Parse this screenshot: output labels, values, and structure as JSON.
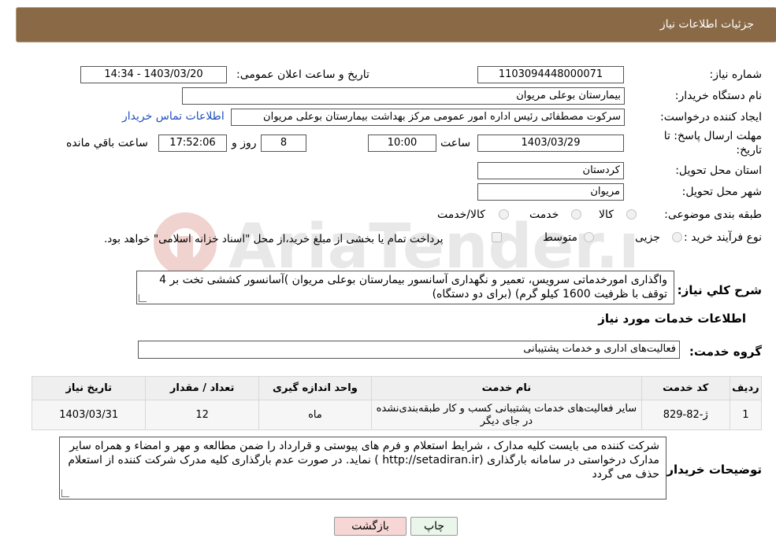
{
  "header": {
    "title": "جزئیات اطلاعات نیاز"
  },
  "form": {
    "need_number_label": "شماره نیاز:",
    "need_number": "1103094448000071",
    "announce_label": "تاریخ و ساعت اعلان عمومی:",
    "announce_value": "1403/03/20 - 14:34",
    "buyer_org_label": "نام دستگاه خریدار:",
    "buyer_org": "بیمارستان بوعلی مریوان",
    "creator_label": "ایجاد کننده درخواست:",
    "creator": "سرکوت مصطفائی رئیس اداره امور عمومی مرکز بهداشت بیمارستان بوعلی مریوان",
    "contact_link": "اطلاعات تماس خریدار",
    "deadline_label_1": "مهلت ارسال پاسخ: تا",
    "deadline_label_2": "تاریخ:",
    "deadline_date": "1403/03/29",
    "time_label": "ساعت",
    "deadline_time": "10:00",
    "days_value": "8",
    "days_label": "روز و",
    "remaining_time": "17:52:06",
    "remaining_label": "ساعت باقي مانده",
    "province_label": "استان محل تحویل:",
    "province": "کردستان",
    "city_label": "شهر محل تحویل:",
    "city": "مریوان",
    "category_label": "طبقه بندی موضوعی:",
    "category_options": [
      "کالا",
      "خدمت",
      "کالا/خدمت"
    ],
    "process_label": "نوع فرآیند خرید :",
    "process_options": [
      "جزیی",
      "متوسط"
    ],
    "payment_note": "پرداخت تمام یا بخشی از مبلغ خرید،از محل \"اسناد خزانه اسلامی\" خواهد بود."
  },
  "description": {
    "label": "شرح کلي نياز:",
    "text": "واگذاری امورخدماتی سرویس، تعمیر و نگهداری آسانسور بیمارستان بوعلی مریوان  )آسانسور کششی تخت بر 4 توقف با ظرفیت 1600 کیلو گرم) (برای دو دستگاه)"
  },
  "services": {
    "section_title": "اطلاعات خدمات مورد نیاز",
    "group_label": "گروه خدمت:",
    "group_value": "فعالیت‌های اداری و خدمات پشتیبانی",
    "columns": [
      "ردیف",
      "کد خدمت",
      "نام خدمت",
      "واحد اندازه گیری",
      "تعداد / مقدار",
      "تاریخ نیاز"
    ],
    "rows": [
      {
        "index": "1",
        "code": "ژ-82-829",
        "name": "سایر فعالیت‌های خدمات پشتیبانی کسب و کار طبقه‌بندی‌نشده در جای دیگر",
        "unit": "ماه",
        "qty": "12",
        "date": "1403/03/31"
      }
    ]
  },
  "buyer_notes": {
    "label": "توضیحات خریدار:",
    "text": "شرکت کننده می بایست  کلیه مدارک ، شرایط استعلام و فرم های پیوستی و قرارداد را ضمن مطالعه و مهر و امضاء و همراه سایر مدارک درخواستی در سامانه بارگذاری  (http://setadiran.ir  )  نماید. در صورت عدم بارگذاری کلیه مدرک شرکت کننده از استعلام حذف می گردد"
  },
  "buttons": {
    "print": "چاپ",
    "back": "بازگشت"
  },
  "watermark": {
    "text": "AriaTender.neT"
  },
  "colors": {
    "header_bg": "#8a6a46",
    "link": "#1f4fbf",
    "back_bg": "#f7d6d6",
    "print_bg": "#eaf6ea"
  }
}
